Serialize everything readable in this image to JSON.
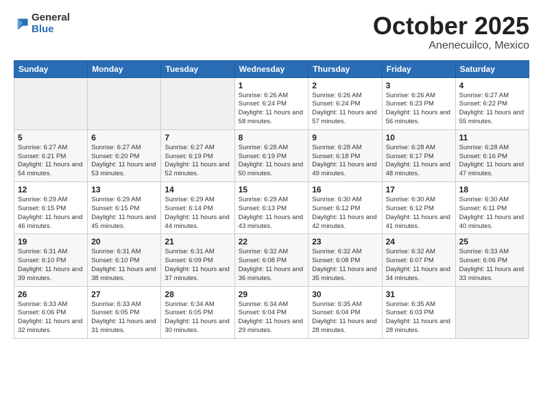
{
  "header": {
    "logo_general": "General",
    "logo_blue": "Blue",
    "month": "October 2025",
    "location": "Anenecuilco, Mexico"
  },
  "weekdays": [
    "Sunday",
    "Monday",
    "Tuesday",
    "Wednesday",
    "Thursday",
    "Friday",
    "Saturday"
  ],
  "weeks": [
    [
      {
        "day": "",
        "sunrise": "",
        "sunset": "",
        "daylight": ""
      },
      {
        "day": "",
        "sunrise": "",
        "sunset": "",
        "daylight": ""
      },
      {
        "day": "",
        "sunrise": "",
        "sunset": "",
        "daylight": ""
      },
      {
        "day": "1",
        "sunrise": "Sunrise: 6:26 AM",
        "sunset": "Sunset: 6:24 PM",
        "daylight": "Daylight: 11 hours and 58 minutes."
      },
      {
        "day": "2",
        "sunrise": "Sunrise: 6:26 AM",
        "sunset": "Sunset: 6:24 PM",
        "daylight": "Daylight: 11 hours and 57 minutes."
      },
      {
        "day": "3",
        "sunrise": "Sunrise: 6:26 AM",
        "sunset": "Sunset: 6:23 PM",
        "daylight": "Daylight: 11 hours and 56 minutes."
      },
      {
        "day": "4",
        "sunrise": "Sunrise: 6:27 AM",
        "sunset": "Sunset: 6:22 PM",
        "daylight": "Daylight: 11 hours and 55 minutes."
      }
    ],
    [
      {
        "day": "5",
        "sunrise": "Sunrise: 6:27 AM",
        "sunset": "Sunset: 6:21 PM",
        "daylight": "Daylight: 11 hours and 54 minutes."
      },
      {
        "day": "6",
        "sunrise": "Sunrise: 6:27 AM",
        "sunset": "Sunset: 6:20 PM",
        "daylight": "Daylight: 11 hours and 53 minutes."
      },
      {
        "day": "7",
        "sunrise": "Sunrise: 6:27 AM",
        "sunset": "Sunset: 6:19 PM",
        "daylight": "Daylight: 11 hours and 52 minutes."
      },
      {
        "day": "8",
        "sunrise": "Sunrise: 6:28 AM",
        "sunset": "Sunset: 6:19 PM",
        "daylight": "Daylight: 11 hours and 50 minutes."
      },
      {
        "day": "9",
        "sunrise": "Sunrise: 6:28 AM",
        "sunset": "Sunset: 6:18 PM",
        "daylight": "Daylight: 11 hours and 49 minutes."
      },
      {
        "day": "10",
        "sunrise": "Sunrise: 6:28 AM",
        "sunset": "Sunset: 6:17 PM",
        "daylight": "Daylight: 11 hours and 48 minutes."
      },
      {
        "day": "11",
        "sunrise": "Sunrise: 6:28 AM",
        "sunset": "Sunset: 6:16 PM",
        "daylight": "Daylight: 11 hours and 47 minutes."
      }
    ],
    [
      {
        "day": "12",
        "sunrise": "Sunrise: 6:29 AM",
        "sunset": "Sunset: 6:15 PM",
        "daylight": "Daylight: 11 hours and 46 minutes."
      },
      {
        "day": "13",
        "sunrise": "Sunrise: 6:29 AM",
        "sunset": "Sunset: 6:15 PM",
        "daylight": "Daylight: 11 hours and 45 minutes."
      },
      {
        "day": "14",
        "sunrise": "Sunrise: 6:29 AM",
        "sunset": "Sunset: 6:14 PM",
        "daylight": "Daylight: 11 hours and 44 minutes."
      },
      {
        "day": "15",
        "sunrise": "Sunrise: 6:29 AM",
        "sunset": "Sunset: 6:13 PM",
        "daylight": "Daylight: 11 hours and 43 minutes."
      },
      {
        "day": "16",
        "sunrise": "Sunrise: 6:30 AM",
        "sunset": "Sunset: 6:12 PM",
        "daylight": "Daylight: 11 hours and 42 minutes."
      },
      {
        "day": "17",
        "sunrise": "Sunrise: 6:30 AM",
        "sunset": "Sunset: 6:12 PM",
        "daylight": "Daylight: 11 hours and 41 minutes."
      },
      {
        "day": "18",
        "sunrise": "Sunrise: 6:30 AM",
        "sunset": "Sunset: 6:11 PM",
        "daylight": "Daylight: 11 hours and 40 minutes."
      }
    ],
    [
      {
        "day": "19",
        "sunrise": "Sunrise: 6:31 AM",
        "sunset": "Sunset: 6:10 PM",
        "daylight": "Daylight: 11 hours and 39 minutes."
      },
      {
        "day": "20",
        "sunrise": "Sunrise: 6:31 AM",
        "sunset": "Sunset: 6:10 PM",
        "daylight": "Daylight: 11 hours and 38 minutes."
      },
      {
        "day": "21",
        "sunrise": "Sunrise: 6:31 AM",
        "sunset": "Sunset: 6:09 PM",
        "daylight": "Daylight: 11 hours and 37 minutes."
      },
      {
        "day": "22",
        "sunrise": "Sunrise: 6:32 AM",
        "sunset": "Sunset: 6:08 PM",
        "daylight": "Daylight: 11 hours and 36 minutes."
      },
      {
        "day": "23",
        "sunrise": "Sunrise: 6:32 AM",
        "sunset": "Sunset: 6:08 PM",
        "daylight": "Daylight: 11 hours and 35 minutes."
      },
      {
        "day": "24",
        "sunrise": "Sunrise: 6:32 AM",
        "sunset": "Sunset: 6:07 PM",
        "daylight": "Daylight: 11 hours and 34 minutes."
      },
      {
        "day": "25",
        "sunrise": "Sunrise: 6:33 AM",
        "sunset": "Sunset: 6:06 PM",
        "daylight": "Daylight: 11 hours and 33 minutes."
      }
    ],
    [
      {
        "day": "26",
        "sunrise": "Sunrise: 6:33 AM",
        "sunset": "Sunset: 6:06 PM",
        "daylight": "Daylight: 11 hours and 32 minutes."
      },
      {
        "day": "27",
        "sunrise": "Sunrise: 6:33 AM",
        "sunset": "Sunset: 6:05 PM",
        "daylight": "Daylight: 11 hours and 31 minutes."
      },
      {
        "day": "28",
        "sunrise": "Sunrise: 6:34 AM",
        "sunset": "Sunset: 6:05 PM",
        "daylight": "Daylight: 11 hours and 30 minutes."
      },
      {
        "day": "29",
        "sunrise": "Sunrise: 6:34 AM",
        "sunset": "Sunset: 6:04 PM",
        "daylight": "Daylight: 11 hours and 29 minutes."
      },
      {
        "day": "30",
        "sunrise": "Sunrise: 6:35 AM",
        "sunset": "Sunset: 6:04 PM",
        "daylight": "Daylight: 11 hours and 28 minutes."
      },
      {
        "day": "31",
        "sunrise": "Sunrise: 6:35 AM",
        "sunset": "Sunset: 6:03 PM",
        "daylight": "Daylight: 11 hours and 28 minutes."
      },
      {
        "day": "",
        "sunrise": "",
        "sunset": "",
        "daylight": ""
      }
    ]
  ]
}
